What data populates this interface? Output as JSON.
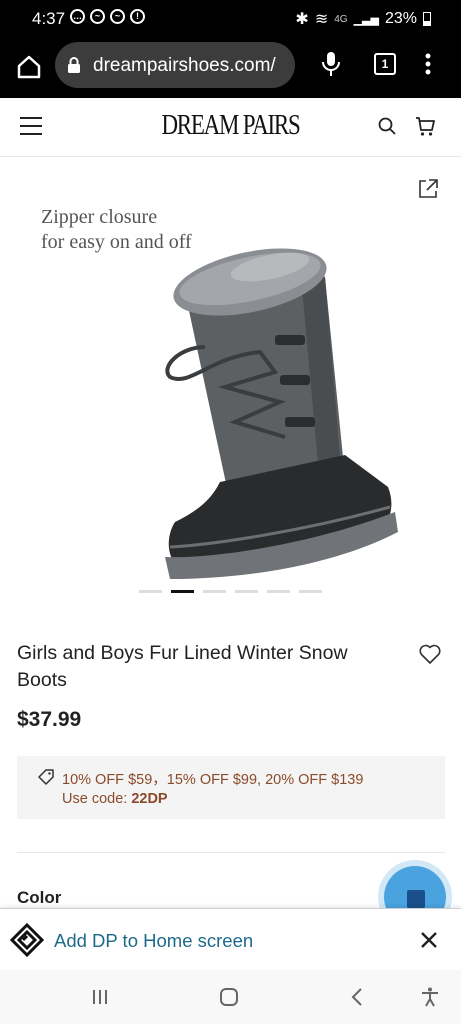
{
  "status": {
    "time": "4:37",
    "network": "4G",
    "battery": "23%"
  },
  "browser": {
    "url": "dreampairshoes.com/",
    "tab_count": "1"
  },
  "site": {
    "logo": "DREAM PAIRS"
  },
  "gallery": {
    "caption_line1": "Zipper closure",
    "caption_line2": "for easy on and off",
    "slide_count": 6,
    "active_slide": 2
  },
  "product": {
    "title": "Girls and Boys Fur Lined Winter Snow Boots",
    "price": "$37.99"
  },
  "promo": {
    "offers": "10% OFF $59，15% OFF $99, 20% OFF $139",
    "code_prefix": "Use code: ",
    "code": "22DP"
  },
  "options": {
    "color_label": "Color"
  },
  "install_banner": {
    "label": "Add DP to Home screen"
  },
  "colors": {
    "accent_blue": "#1e6a8a",
    "promo_text": "#8a4b2a",
    "fab": "#4aa3df"
  },
  "icons": [
    "home-icon",
    "lock-icon",
    "mic-icon",
    "tabs-icon",
    "more-vert-icon",
    "menu-icon",
    "search-icon",
    "cart-icon",
    "share-icon",
    "heart-icon",
    "tag-icon",
    "close-icon",
    "recents-icon",
    "home-nav-icon",
    "back-icon",
    "accessibility-icon"
  ]
}
